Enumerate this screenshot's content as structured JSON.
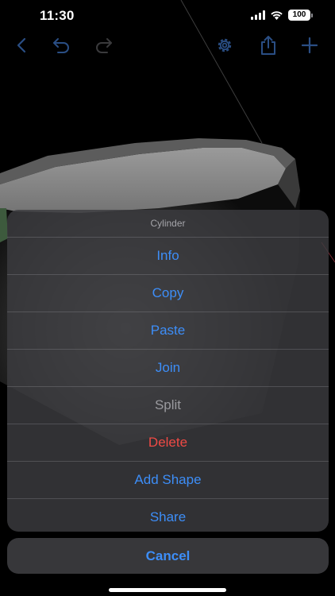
{
  "status_bar": {
    "time": "11:30",
    "battery": "100",
    "icons": [
      "signal-icon",
      "wifi-icon",
      "battery-icon"
    ]
  },
  "toolbar": {
    "left": [
      "back-chevron-icon",
      "undo-icon",
      "redo-icon"
    ],
    "right": [
      "gear-icon",
      "share-icon",
      "plus-icon"
    ]
  },
  "action_sheet": {
    "title": "Cylinder",
    "items": [
      {
        "label": "Info",
        "state": "normal"
      },
      {
        "label": "Copy",
        "state": "normal"
      },
      {
        "label": "Paste",
        "state": "normal"
      },
      {
        "label": "Join",
        "state": "normal"
      },
      {
        "label": "Split",
        "state": "disabled"
      },
      {
        "label": "Delete",
        "state": "destructive"
      },
      {
        "label": "Add Shape",
        "state": "normal"
      },
      {
        "label": "Share",
        "state": "normal"
      }
    ],
    "cancel_label": "Cancel"
  },
  "colors": {
    "tint": "#3d8ef8",
    "tint_disabled": "#2a4e84",
    "destructive": "#ef4a45",
    "disabled_text": "#9a9a9f",
    "sheet_background": "#3c3c3f",
    "viewport_background": "#000000"
  }
}
